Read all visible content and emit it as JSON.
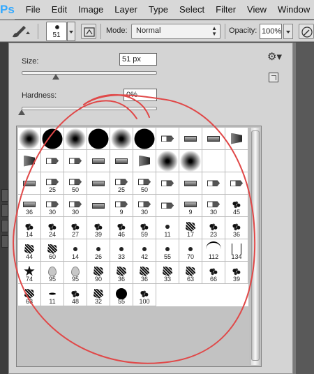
{
  "app": {
    "logo": "Ps"
  },
  "menu": [
    "File",
    "Edit",
    "Image",
    "Layer",
    "Type",
    "Select",
    "Filter",
    "View",
    "Window"
  ],
  "options": {
    "preset_size": "51",
    "mode_label": "Mode:",
    "mode_value": "Normal",
    "opacity_label": "Opacity:",
    "opacity_value": "100%"
  },
  "picker": {
    "size_label": "Size:",
    "size_value": "51 px",
    "size_fraction": 0.25,
    "hardness_label": "Hardness:",
    "hardness_value": "0%",
    "hardness_fraction": 0.0
  },
  "brushes": [
    {
      "shape": "soft",
      "label": ""
    },
    {
      "shape": "hard",
      "label": ""
    },
    {
      "shape": "soft",
      "label": ""
    },
    {
      "shape": "hard",
      "label": ""
    },
    {
      "shape": "soft",
      "label": ""
    },
    {
      "shape": "hard",
      "label": ""
    },
    {
      "shape": "marker2",
      "label": ""
    },
    {
      "shape": "marker",
      "label": ""
    },
    {
      "shape": "marker",
      "label": ""
    },
    {
      "shape": "fan",
      "label": ""
    },
    {
      "shape": "fan",
      "label": ""
    },
    {
      "shape": "marker2",
      "label": ""
    },
    {
      "shape": "marker2",
      "label": ""
    },
    {
      "shape": "marker",
      "label": ""
    },
    {
      "shape": "marker",
      "label": ""
    },
    {
      "shape": "fan",
      "label": ""
    },
    {
      "shape": "soft",
      "label": ""
    },
    {
      "shape": "soft",
      "label": ""
    },
    {
      "shape": "",
      "label": ""
    },
    {
      "shape": "",
      "label": ""
    },
    {
      "shape": "marker",
      "label": ""
    },
    {
      "shape": "marker2",
      "label": "25"
    },
    {
      "shape": "marker2",
      "label": "50"
    },
    {
      "shape": "marker",
      "label": ""
    },
    {
      "shape": "marker2",
      "label": "25"
    },
    {
      "shape": "marker2",
      "label": "50"
    },
    {
      "shape": "marker2",
      "label": ""
    },
    {
      "shape": "marker",
      "label": ""
    },
    {
      "shape": "marker2",
      "label": ""
    },
    {
      "shape": "marker2",
      "label": ""
    },
    {
      "shape": "marker",
      "label": "36"
    },
    {
      "shape": "marker2",
      "label": "30"
    },
    {
      "shape": "marker2",
      "label": "30"
    },
    {
      "shape": "marker",
      "label": ""
    },
    {
      "shape": "marker2",
      "label": "9"
    },
    {
      "shape": "marker2",
      "label": "30"
    },
    {
      "shape": "marker2",
      "label": ""
    },
    {
      "shape": "marker",
      "label": "9"
    },
    {
      "shape": "marker2",
      "label": "30"
    },
    {
      "shape": "splat",
      "label": "45"
    },
    {
      "shape": "splat",
      "label": "14"
    },
    {
      "shape": "splat",
      "label": "24"
    },
    {
      "shape": "splat",
      "label": "27"
    },
    {
      "shape": "splat",
      "label": "39"
    },
    {
      "shape": "splat",
      "label": "46"
    },
    {
      "shape": "splat",
      "label": "59"
    },
    {
      "shape": "dot",
      "label": "11"
    },
    {
      "shape": "dense",
      "label": "17"
    },
    {
      "shape": "splat",
      "label": "23"
    },
    {
      "shape": "splat",
      "label": "36"
    },
    {
      "shape": "dense",
      "label": "44"
    },
    {
      "shape": "dense",
      "label": "60"
    },
    {
      "shape": "dot",
      "label": "14"
    },
    {
      "shape": "dot",
      "label": "26"
    },
    {
      "shape": "dot",
      "label": "33"
    },
    {
      "shape": "dot",
      "label": "42"
    },
    {
      "shape": "dot",
      "label": "55"
    },
    {
      "shape": "dot",
      "label": "70"
    },
    {
      "shape": "arc",
      "label": "112"
    },
    {
      "shape": "grass",
      "label": "134"
    },
    {
      "shape": "star",
      "label": "74"
    },
    {
      "shape": "leaf",
      "label": "95"
    },
    {
      "shape": "leaf",
      "label": "95"
    },
    {
      "shape": "dense",
      "label": "90"
    },
    {
      "shape": "dense",
      "label": "36"
    },
    {
      "shape": "dense",
      "label": "36"
    },
    {
      "shape": "dense",
      "label": "33"
    },
    {
      "shape": "dense",
      "label": "63"
    },
    {
      "shape": "splat",
      "label": "66"
    },
    {
      "shape": "splat",
      "label": "39"
    },
    {
      "shape": "dense",
      "label": "63"
    },
    {
      "shape": "streak",
      "label": "11"
    },
    {
      "shape": "splat",
      "label": "48"
    },
    {
      "shape": "dense",
      "label": "32"
    },
    {
      "shape": "hard-sm",
      "label": "55"
    },
    {
      "shape": "splat",
      "label": "100"
    }
  ],
  "colors": {
    "annotation": "#e04848",
    "accent": "#31a8ff"
  }
}
